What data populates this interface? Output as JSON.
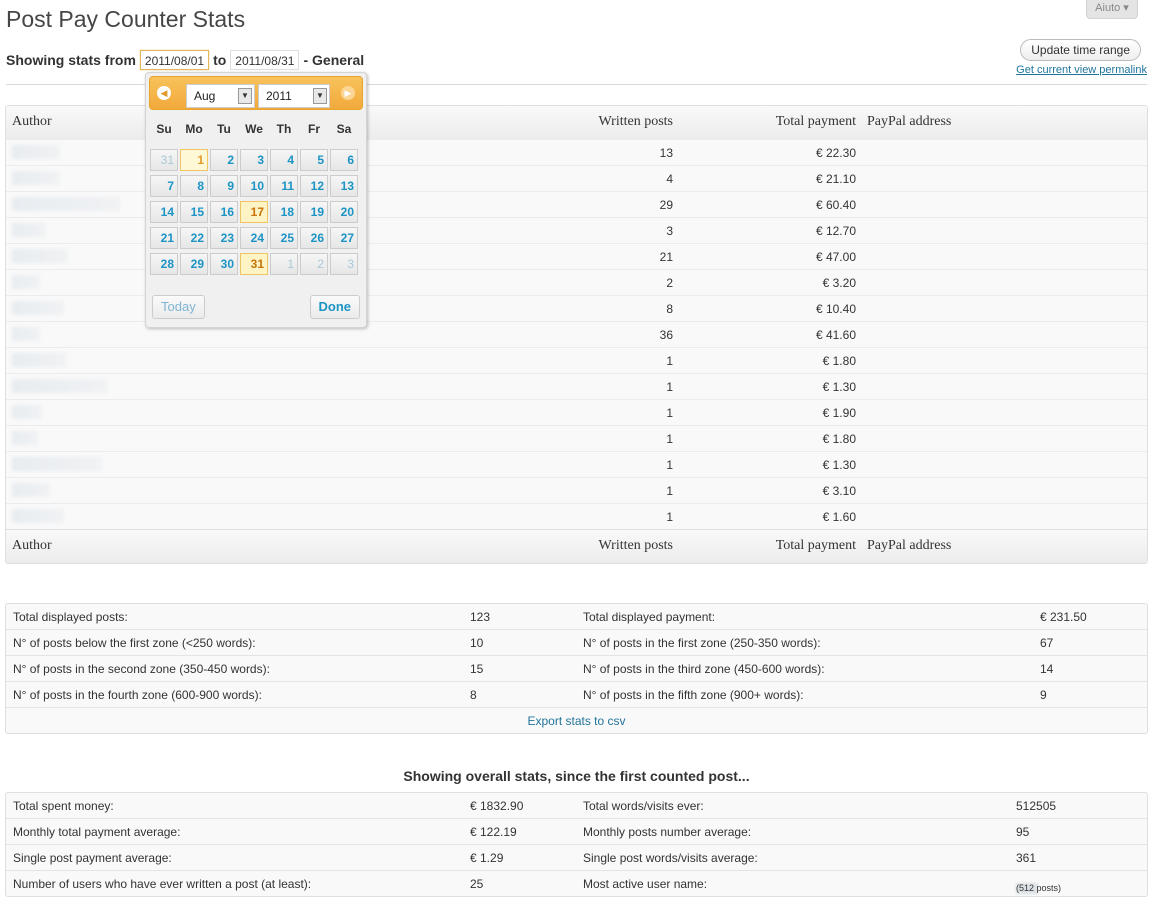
{
  "header": {
    "title": "Post Pay Counter Stats",
    "help_label": "Aiuto ▾"
  },
  "range": {
    "showing_label": "Showing stats from",
    "from": "2011/08/01",
    "to_label": "to",
    "to": "2011/08/31",
    "general_label": "- General",
    "update_button": "Update time range",
    "permalink": "Get current view permalink"
  },
  "table": {
    "headers": {
      "author": "Author",
      "written": "Written posts",
      "payment": "Total payment",
      "paypal": "PayPal address"
    },
    "rows": [
      {
        "written": "13",
        "payment": "€ 22.30"
      },
      {
        "written": "4",
        "payment": "€ 21.10"
      },
      {
        "written": "29",
        "payment": "€ 60.40"
      },
      {
        "written": "3",
        "payment": "€ 12.70"
      },
      {
        "written": "21",
        "payment": "€ 47.00"
      },
      {
        "written": "2",
        "payment": "€ 3.20"
      },
      {
        "written": "8",
        "payment": "€ 10.40"
      },
      {
        "written": "36",
        "payment": "€ 41.60"
      },
      {
        "written": "1",
        "payment": "€ 1.80"
      },
      {
        "written": "1",
        "payment": "€ 1.30"
      },
      {
        "written": "1",
        "payment": "€ 1.90"
      },
      {
        "written": "1",
        "payment": "€ 1.80"
      },
      {
        "written": "1",
        "payment": "€ 1.30"
      },
      {
        "written": "1",
        "payment": "€ 3.10"
      },
      {
        "written": "1",
        "payment": "€ 1.60"
      }
    ]
  },
  "summary": {
    "rows": [
      [
        "Total displayed posts:",
        "123",
        "Total displayed payment:",
        "€ 231.50"
      ],
      [
        "N° of posts below the first zone (<250 words):",
        "10",
        "N° of posts in the first zone (250-350 words):",
        "67"
      ],
      [
        "N° of posts in the second zone (350-450 words):",
        "15",
        "N° of posts in the third zone (450-600 words):",
        "14"
      ],
      [
        "N° of posts in the fourth zone (600-900 words):",
        "8",
        "N° of posts in the fifth zone (900+ words):",
        "9"
      ]
    ],
    "export_link": "Export stats to csv"
  },
  "overall": {
    "title": "Showing overall stats, since the first counted post...",
    "rows": [
      [
        "Total spent money:",
        "€ 1832.90",
        "Total words/visits ever:",
        "512505"
      ],
      [
        "Monthly total payment average:",
        "€ 122.19",
        "Monthly posts number average:",
        "95"
      ],
      [
        "Single post payment average:",
        "€ 1.29",
        "Single post words/visits average:",
        "361"
      ],
      [
        "Number of users who have ever written a post (at least):",
        "25",
        "Most active user name:",
        "(512 posts)"
      ]
    ]
  },
  "datepicker": {
    "month": "Aug",
    "year": "2011",
    "dow": [
      "Su",
      "Mo",
      "Tu",
      "We",
      "Th",
      "Fr",
      "Sa"
    ],
    "weeks": [
      [
        "31",
        "1",
        "2",
        "3",
        "4",
        "5",
        "6"
      ],
      [
        "7",
        "8",
        "9",
        "10",
        "11",
        "12",
        "13"
      ],
      [
        "14",
        "15",
        "16",
        "17",
        "18",
        "19",
        "20"
      ],
      [
        "21",
        "22",
        "23",
        "24",
        "25",
        "26",
        "27"
      ],
      [
        "28",
        "29",
        "30",
        "31",
        "1",
        "2",
        "3"
      ]
    ],
    "today_button": "Today",
    "done_button": "Done",
    "colors": {
      "header": "#f2a93c",
      "link": "#1c94c4",
      "highlight": "#fef3c5"
    }
  }
}
